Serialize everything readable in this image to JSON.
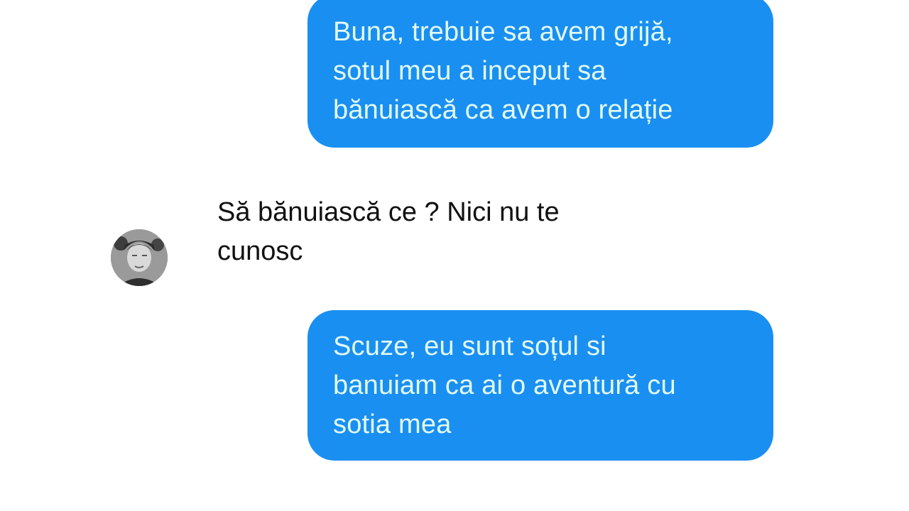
{
  "messages": [
    {
      "direction": "outgoing",
      "text": "Buna, trebuie sa avem grijă,\nsotul meu a inceput sa\nbănuiască ca avem o relație"
    },
    {
      "direction": "incoming",
      "text": "Să bănuiască ce ? Nici nu te\ncunosc",
      "avatar_icon": "user-avatar-icon"
    },
    {
      "direction": "outgoing",
      "text": "Scuze, eu sunt soțul si\nbanuiam ca ai o aventură cu\nsotia mea"
    }
  ],
  "colors": {
    "outgoing_bubble": "#1a8ff2",
    "outgoing_text": "#e2fbf0",
    "incoming_text": "#111111",
    "background": "#ffffff"
  }
}
